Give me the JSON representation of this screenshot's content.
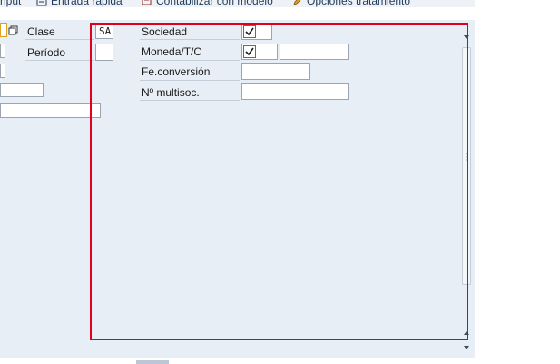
{
  "toolbar": {
    "item1": "nput",
    "item2": "Entrada rápida",
    "item3": "Contabilizar con modelo",
    "item4": "Opciones tratamiento"
  },
  "form": {
    "clase_label": "Clase",
    "clase_value": "SA",
    "periodo_label": "Período",
    "periodo_value": "",
    "sociedad_label": "Sociedad",
    "sociedad_checked": true,
    "sociedad_value": "",
    "moneda_label": "Moneda/T/C",
    "moneda_checked": true,
    "moneda_value": "",
    "feconv_label": "Fe.conversión",
    "feconv_value": "",
    "multisoc_label": "Nº multisoc.",
    "multisoc_value": ""
  },
  "colors": {
    "highlight": "#e0001b",
    "panel_bg": "#e8eef5"
  },
  "icons": [
    "copy-icon",
    "quick-entry-icon",
    "model-post-icon",
    "pencil-icon",
    "check-icon",
    "scroll-up-icon",
    "scroll-down-icon"
  ]
}
